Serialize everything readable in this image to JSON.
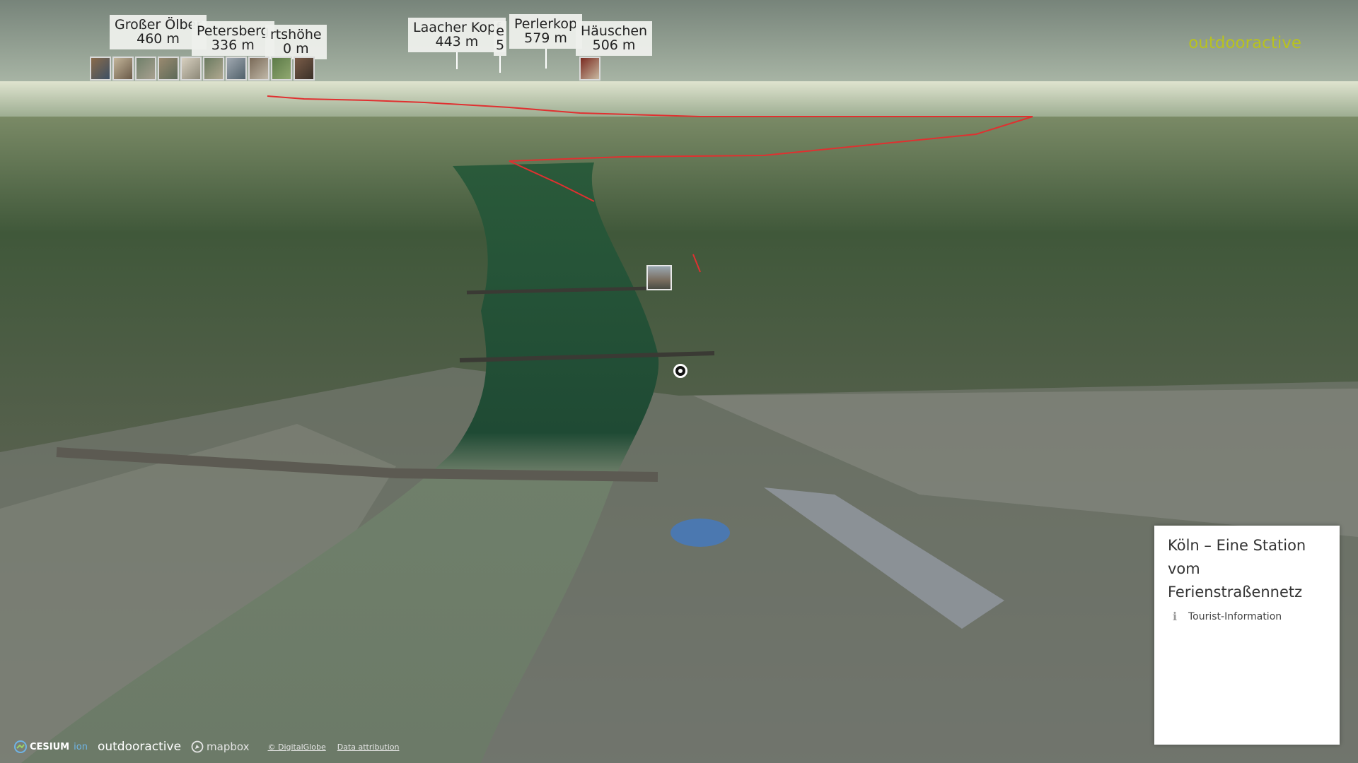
{
  "peaks": [
    {
      "name": "Großer Ölber",
      "elevation": "460 m"
    },
    {
      "name": "Petersberg",
      "elevation": "336 m"
    },
    {
      "name": "rtshöhe",
      "elevation": "0 m"
    },
    {
      "name": "Laacher Kopf",
      "elevation": "443 m"
    },
    {
      "name": "e",
      "elevation": "5"
    },
    {
      "name": "Perlerkop",
      "elevation": "579 m"
    },
    {
      "name": "Häuschen",
      "elevation": "506 m"
    }
  ],
  "brand_top": "outdooractive",
  "info_card": {
    "title_lines": [
      "Köln – Eine Station",
      "vom",
      "Ferienstraßennetz"
    ],
    "category": "Tourist-Information",
    "category_icon": "info-icon"
  },
  "footer": {
    "cesium": "CESIUM",
    "cesium_suffix": "ion",
    "outdooractive": "outdooractive",
    "mapbox": "mapbox",
    "copyright": "© DigitalGlobe",
    "attribution": "Data attribution"
  },
  "colors": {
    "route": "#e03030",
    "brand_accent": "#b8c21f",
    "river": "#6e7f6a"
  }
}
